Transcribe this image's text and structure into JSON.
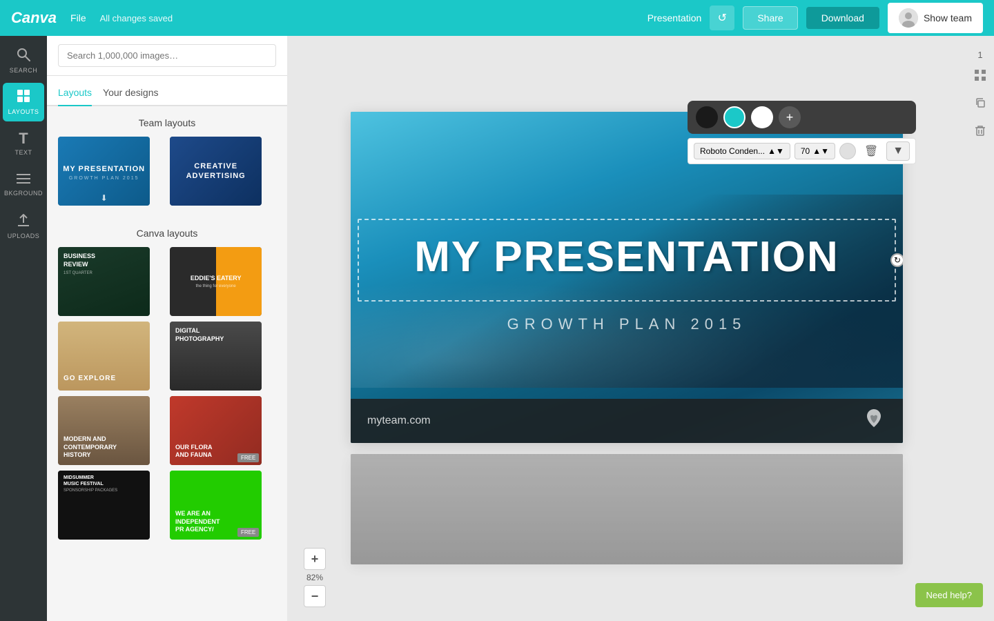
{
  "topbar": {
    "logo": "Canva",
    "file_label": "File",
    "saved_label": "All changes saved",
    "presentation_label": "Presentation",
    "undo_symbol": "↺",
    "share_label": "Share",
    "download_label": "Download",
    "show_team_label": "Show team"
  },
  "left_icons": [
    {
      "id": "search",
      "symbol": "🔍",
      "label": "SEARCH",
      "active": false
    },
    {
      "id": "layouts",
      "symbol": "⊞",
      "label": "LAYOUTS",
      "active": true
    },
    {
      "id": "text",
      "symbol": "T",
      "label": "TEXT",
      "active": false
    },
    {
      "id": "background",
      "symbol": "≡",
      "label": "BKGROUND",
      "active": false
    },
    {
      "id": "uploads",
      "symbol": "↑",
      "label": "UPLOADS",
      "active": false
    }
  ],
  "panel": {
    "search_placeholder": "Search 1,000,000 images…",
    "tabs": [
      "Layouts",
      "Your designs"
    ],
    "active_tab": "Layouts",
    "team_section_title": "Team layouts",
    "canva_section_title": "Canva layouts",
    "team_layouts": [
      {
        "id": "t1",
        "text": "MY PRESENTATION",
        "bg": "#2471a3",
        "has_download": true
      },
      {
        "id": "t2",
        "text": "CREATIVE ADVERTISING",
        "bg": "#1a5276",
        "has_download": false
      }
    ],
    "canva_layouts": [
      {
        "id": "c1",
        "text": "BUSINESS REVIEW",
        "bg": "#1a3a2a",
        "free": false
      },
      {
        "id": "c2",
        "text": "EDDIE'S EATERY",
        "bg": "#f39c12",
        "free": false
      },
      {
        "id": "c3",
        "text": "GO EXPLORE",
        "bg": "#c9a96e",
        "free": false
      },
      {
        "id": "c4",
        "text": "DIGITAL PHOTOGRAPHY",
        "bg": "#3d3d3d",
        "free": false
      },
      {
        "id": "c5",
        "text": "MODERN AND CONTEMPORARY HISTORY",
        "bg": "#8B7355",
        "free": false
      },
      {
        "id": "c6",
        "text": "OUR FLORA AND FAUNA",
        "bg": "#c0392b",
        "free": false
      },
      {
        "id": "c7",
        "text": "MIDSUMMER SPONSORSHIP PACKAGES",
        "bg": "#1a1a1a",
        "free": false
      },
      {
        "id": "c8",
        "text": "WE ARE AN INDEPENDENT PR AGENCY/",
        "bg": "#00cc00",
        "free": true
      }
    ]
  },
  "toolbar": {
    "colors": [
      "#1a1a1a",
      "#1bc8c8",
      "#ffffff"
    ],
    "font_name": "Roboto Conden...",
    "font_size": "70",
    "add_color_symbol": "+",
    "delete_symbol": "🗑",
    "arrow_symbol": "▼"
  },
  "slide": {
    "title": "MY PRESENTATION",
    "subtitle": "GROWTH PLAN 2015",
    "footer_url": "myteam.com",
    "footer_logo": "🌿"
  },
  "right_sidebar": {
    "slide_number": "1",
    "grid_icon": "⋮⋮",
    "copy_icon": "⧉",
    "delete_icon": "🗑"
  },
  "zoom": {
    "plus_label": "+",
    "level": "82%",
    "minus_label": "−"
  },
  "help": {
    "label": "Need help?"
  }
}
